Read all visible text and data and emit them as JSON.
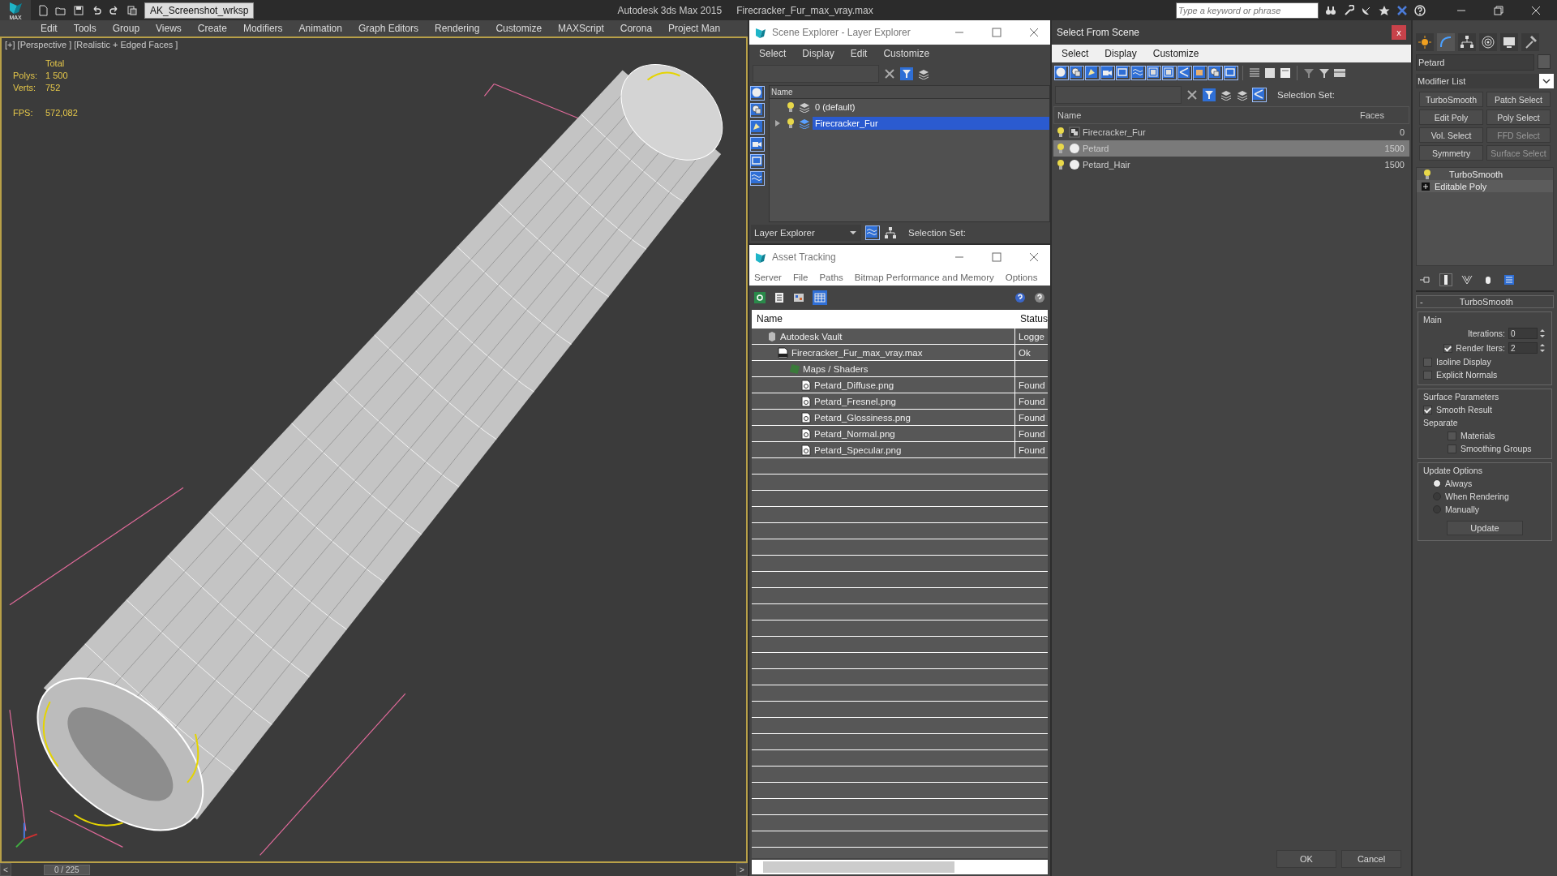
{
  "title_bar": {
    "logo_label": "MAX",
    "workspace": "AK_Screenshot_wrksp",
    "app": "Autodesk 3ds Max  2015",
    "file": "Firecracker_Fur_max_vray.max",
    "search": {
      "placeholder": "Type a keyword or phrase"
    }
  },
  "menu": [
    "Edit",
    "Tools",
    "Group",
    "Views",
    "Create",
    "Modifiers",
    "Animation",
    "Graph Editors",
    "Rendering",
    "Customize",
    "MAXScript",
    "Corona",
    "Project Man"
  ],
  "viewport": {
    "label": "[+] [Perspective ] [Realistic + Edged Faces ]",
    "stats_header": "Total",
    "stats": [
      {
        "label": "Polys:",
        "value": "1 500"
      },
      {
        "label": "Verts:",
        "value": "752"
      }
    ],
    "fps_label": "FPS:",
    "fps": "572,082"
  },
  "timeline": {
    "prev": "<",
    "frame": "0 / 225",
    "level": 0,
    "next": ">"
  },
  "scene_explorer": {
    "title": "Scene Explorer - Layer Explorer",
    "menu": [
      "Select",
      "Display",
      "Edit",
      "Customize"
    ],
    "column": "Name",
    "layers": [
      {
        "name": "0 (default)",
        "has_children": false,
        "selected": false
      },
      {
        "name": "Firecracker_Fur",
        "has_children": true,
        "selected": true
      }
    ],
    "explorer_mode": "Layer Explorer",
    "selection_set_label": "Selection Set:"
  },
  "asset_tracking": {
    "title": "Asset Tracking",
    "menu": [
      "Server",
      "File",
      "Paths",
      "Bitmap Performance and Memory",
      "Options"
    ],
    "columns": [
      "Name",
      "Status"
    ],
    "assets": [
      {
        "name": "Autodesk Vault",
        "status": "Logge",
        "kind": "vault",
        "children": [
          {
            "name": "Firecracker_Fur_max_vray.max",
            "status": "Ok",
            "kind": "file",
            "children": [
              {
                "name": "Maps / Shaders",
                "kind": "folder",
                "children": [
                  {
                    "name": "Petard_Diffuse.png",
                    "status": "Found",
                    "kind": "image"
                  },
                  {
                    "name": "Petard_Fresnel.png",
                    "status": "Found",
                    "kind": "image"
                  },
                  {
                    "name": "Petard_Glossiness.png",
                    "status": "Found",
                    "kind": "image"
                  },
                  {
                    "name": "Petard_Normal.png",
                    "status": "Found",
                    "kind": "image"
                  },
                  {
                    "name": "Petard_Specular.png",
                    "status": "Found",
                    "kind": "image"
                  }
                ]
              }
            ]
          }
        ]
      }
    ]
  },
  "select_from_scene": {
    "title": "Select From Scene",
    "close": "x",
    "menu": [
      "Select",
      "Display",
      "Customize"
    ],
    "selection_set_label": "Selection Set:",
    "columns": [
      "Name",
      "Faces"
    ],
    "objects": [
      {
        "name": "Firecracker_Fur",
        "faces": "0",
        "kind": "group",
        "selected": false
      },
      {
        "name": "Petard",
        "faces": "1500",
        "kind": "geometry",
        "selected": true
      },
      {
        "name": "Petard_Hair",
        "faces": "1500",
        "kind": "geometry",
        "selected": false
      }
    ],
    "buttons": [
      "OK",
      "Cancel"
    ]
  },
  "command_panel": {
    "object_name": "Petard",
    "modifier_list": "Modifier List",
    "modifier_buttons": [
      {
        "label": "TurboSmooth",
        "disabled": false
      },
      {
        "label": "Patch Select",
        "disabled": false
      },
      {
        "label": "Edit Poly",
        "disabled": false
      },
      {
        "label": "Poly Select",
        "disabled": false
      },
      {
        "label": "Vol. Select",
        "disabled": false
      },
      {
        "label": "FFD Select",
        "disabled": true
      },
      {
        "label": "Symmetry",
        "disabled": false
      },
      {
        "label": "Surface Select",
        "disabled": true
      }
    ],
    "stack": [
      {
        "name": "TurboSmooth",
        "kind": "modifier",
        "selected": false
      },
      {
        "name": "Editable Poly",
        "kind": "base",
        "selected": true
      }
    ],
    "rollout": {
      "toggle": "-",
      "title": "TurboSmooth",
      "main": {
        "label": "Main",
        "iterations_label": "Iterations:",
        "iterations": "0",
        "render_iters": {
          "label": "Render Iters:",
          "checked": true,
          "value": "2"
        },
        "checks": [
          {
            "label": "Isoline Display",
            "checked": false
          },
          {
            "label": "Explicit Normals",
            "checked": false
          }
        ]
      },
      "surface": {
        "label": "Surface Parameters",
        "smooth_result": {
          "label": "Smooth Result",
          "checked": true
        },
        "separate_label": "Separate",
        "checks": [
          {
            "label": "Materials",
            "checked": false
          },
          {
            "label": "Smoothing Groups",
            "checked": false
          }
        ]
      },
      "update": {
        "label": "Update Options",
        "radios": [
          {
            "label": "Always",
            "selected": true
          },
          {
            "label": "When Rendering",
            "selected": false
          },
          {
            "label": "Manually",
            "selected": false
          }
        ],
        "button": "Update"
      }
    }
  }
}
